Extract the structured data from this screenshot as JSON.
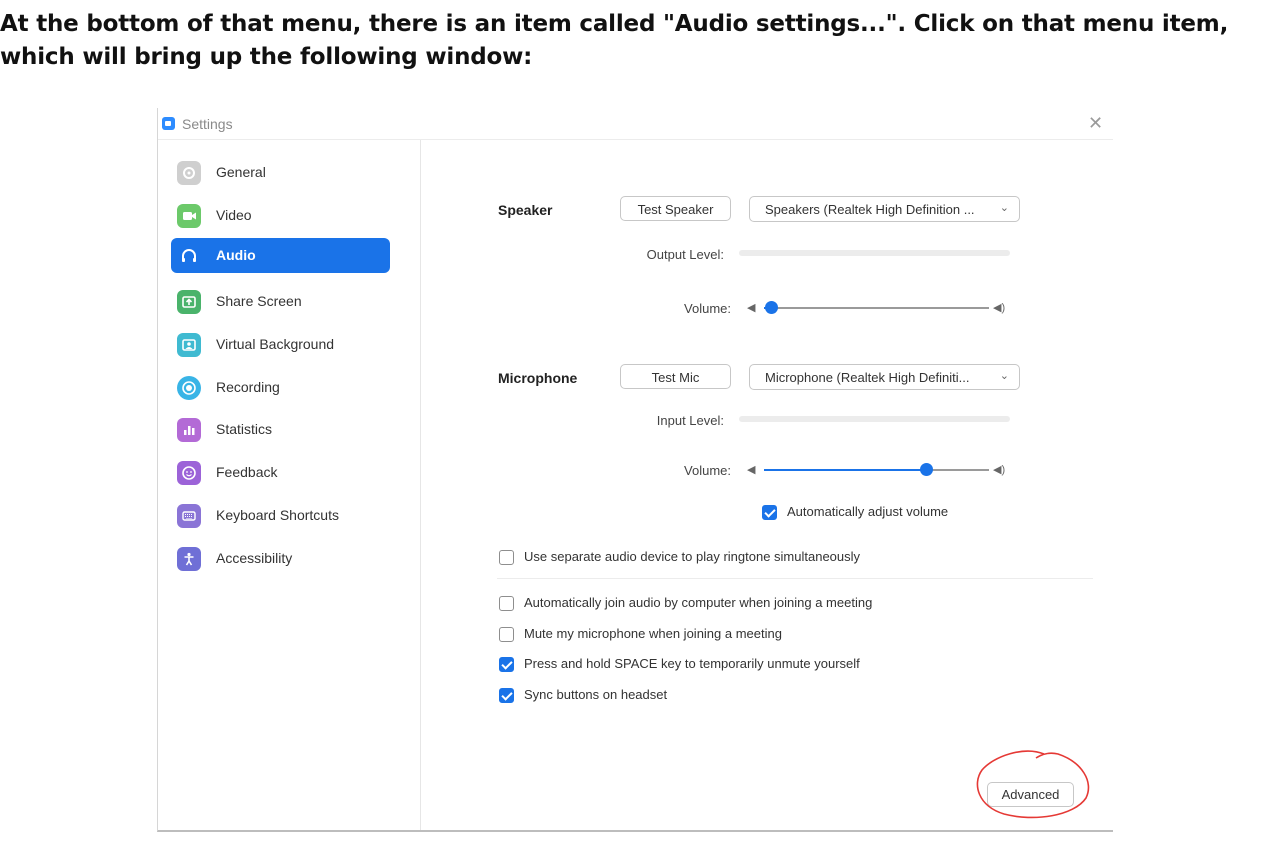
{
  "instruction": {
    "line1": "At the bottom of that menu, there is an item called \"Audio settings...\". Click on that menu item,",
    "line2": "which will bring up the following window:"
  },
  "window": {
    "title": "Settings",
    "close_glyph": "✕"
  },
  "sidebar": {
    "active": "Audio",
    "items": [
      {
        "label": "General",
        "icon": "gear-icon",
        "color": "#c8c8c8"
      },
      {
        "label": "Video",
        "icon": "video-camera-icon",
        "color": "#6cc96a"
      },
      {
        "label": "Audio",
        "icon": "headphones-icon",
        "color": "#1a73e8"
      },
      {
        "label": "Share Screen",
        "icon": "share-screen-icon",
        "color": "#4ab36b"
      },
      {
        "label": "Virtual Background",
        "icon": "virtual-background-icon",
        "color": "#3fbad1"
      },
      {
        "label": "Recording",
        "icon": "recording-icon",
        "color": "#39b4e6"
      },
      {
        "label": "Statistics",
        "icon": "statistics-icon",
        "color": "#b36ad6"
      },
      {
        "label": "Feedback",
        "icon": "feedback-icon",
        "color": "#9c63d8"
      },
      {
        "label": "Keyboard Shortcuts",
        "icon": "keyboard-icon",
        "color": "#8a74d6"
      },
      {
        "label": "Accessibility",
        "icon": "accessibility-icon",
        "color": "#6f6fd6"
      }
    ]
  },
  "speaker": {
    "label": "Speaker",
    "test_button": "Test Speaker",
    "device": "Speakers (Realtek High Definition ...",
    "output_level_label": "Output Level:",
    "output_level": 0,
    "volume_label": "Volume:",
    "volume": 0.03
  },
  "microphone": {
    "label": "Microphone",
    "test_button": "Test Mic",
    "device": "Microphone (Realtek High Definiti...",
    "input_level_label": "Input Level:",
    "input_level": 0,
    "volume_label": "Volume:",
    "volume": 0.72,
    "auto_adjust": {
      "label": "Automatically adjust volume",
      "checked": true
    }
  },
  "options": {
    "separate_device": {
      "label": "Use separate audio device to play ringtone simultaneously",
      "checked": false
    },
    "auto_join": {
      "label": "Automatically join audio by computer when joining a meeting",
      "checked": false
    },
    "mute_on_join": {
      "label": "Mute my microphone when joining a meeting",
      "checked": false
    },
    "space_unmute": {
      "label": "Press and hold SPACE key to temporarily unmute yourself",
      "checked": true
    },
    "sync_headset": {
      "label": "Sync buttons on headset",
      "checked": true
    }
  },
  "advanced_button": "Advanced",
  "colors": {
    "accent": "#1a73e8",
    "annotation": "#e53935"
  }
}
